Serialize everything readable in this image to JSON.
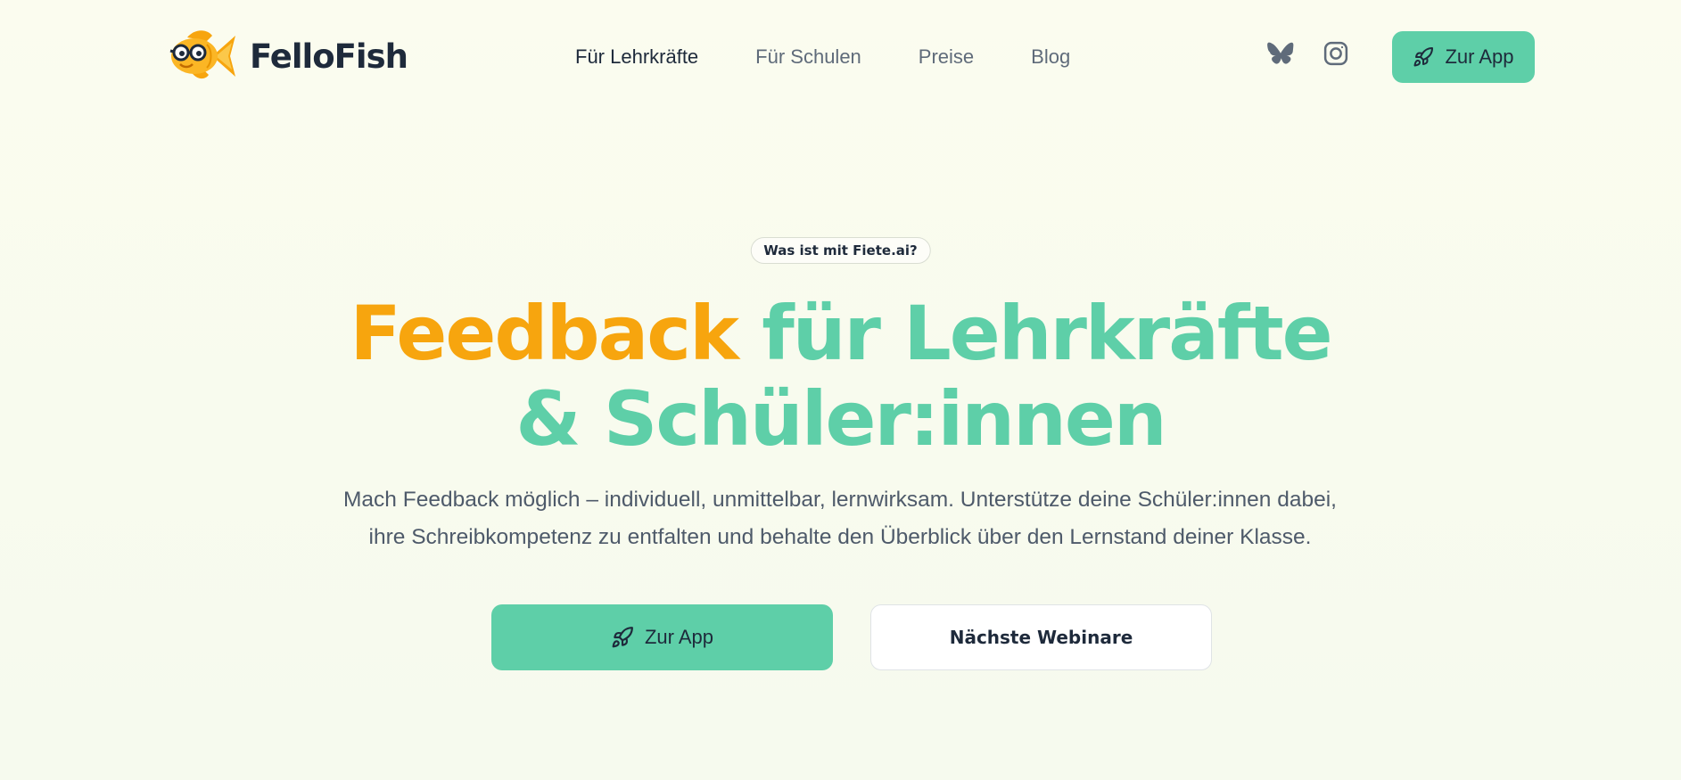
{
  "header": {
    "logo_text": "FelloFish",
    "nav": [
      {
        "label": "Für Lehrkräfte",
        "active": true
      },
      {
        "label": "Für Schulen"
      },
      {
        "label": "Preise"
      },
      {
        "label": "Blog"
      }
    ],
    "social": [
      "bluesky-icon",
      "instagram-icon"
    ],
    "cta_label": "Zur App",
    "cta_icon": "rocket-icon"
  },
  "hero": {
    "badge": "Was ist mit Fiete.ai?",
    "headline_highlight": "Feedback",
    "headline_rest": "für Lehrkräfte",
    "headline_line2": "& Schüler:innen",
    "subtitle_line1": "Mach Feedback möglich – individuell, unmittelbar, lernwirksam. Unterstütze deine Schüler:innen dabei,",
    "subtitle_line2": "ihre Schreibkompetenz zu entfalten und behalte den Überblick über den Lernstand deiner Klasse.",
    "primary_label": "Zur App",
    "secondary_label": "Nächste Webinare"
  },
  "colors": {
    "accent_green": "#5ecfa8",
    "accent_orange": "#f7a50e",
    "text_dark": "#1e2a3b",
    "background": "#fafcf0"
  }
}
